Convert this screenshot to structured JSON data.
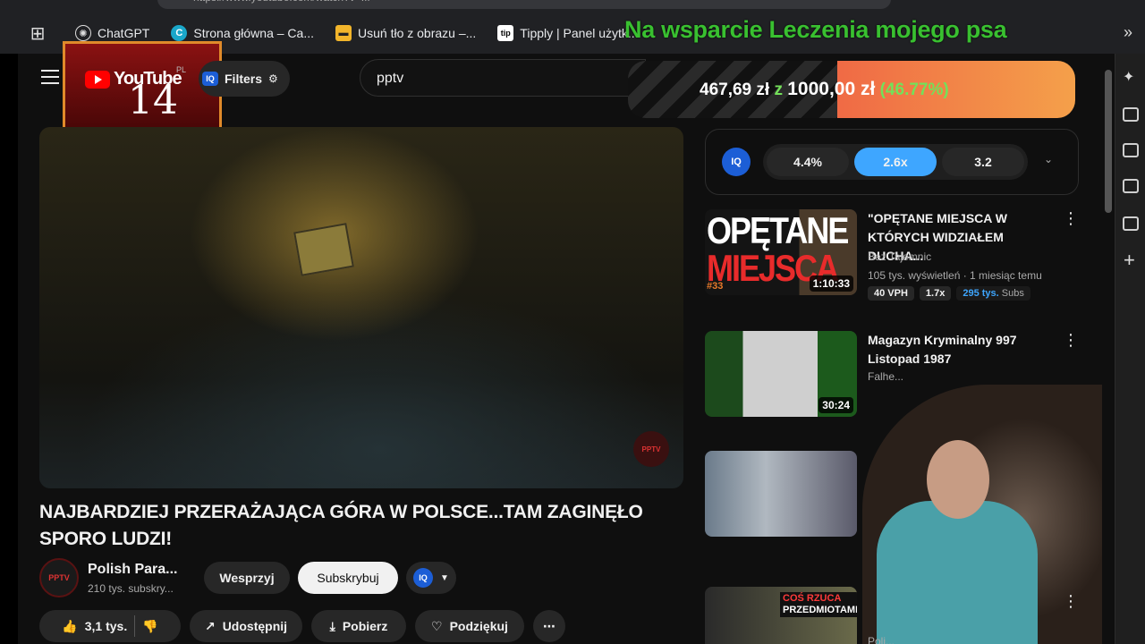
{
  "browser": {
    "url": "https://www.youtube.com/watch?v=...",
    "bookmarks": [
      {
        "label": "ChatGPT",
        "icon": "chatgpt-icon"
      },
      {
        "label": "Strona główna – Ca...",
        "icon": "canva-icon"
      },
      {
        "label": "Usuń tło z obrazu –...",
        "icon": "removebg-icon"
      },
      {
        "label": "Tipply | Panel użytk...",
        "icon": "tipply-icon"
      }
    ]
  },
  "overlay": {
    "support_text": "Na wsparcie Leczenia mojego psa"
  },
  "donation_goal": {
    "current": "467,69 zł",
    "separator": "z",
    "target": "1000,00 zł",
    "percent_text": "(46.77%)",
    "progress": 0.4677
  },
  "header": {
    "logo_word": "YouTube",
    "logo_region": "PL",
    "logo_overlay_number": "14",
    "filters_label": "Filters",
    "iq_label": "IQ",
    "search_value": "pptv"
  },
  "video": {
    "title": "NAJBARDZIEJ PRZERAŻAJĄCA GÓRA W POLSCE...TAM ZAGINĘŁO SPORO LUDZI!",
    "watermark": "PPTV",
    "channel_name": "Polish Para...",
    "channel_subs": "210 tys. subskry...",
    "channel_avatar_text": "PPTV",
    "support_button": "Wesprzyj",
    "subscribe_button": "Subskrybuj",
    "likes": "3,1 tys.",
    "share": "Udostępnij",
    "download": "Pobierz",
    "thanks": "Podziękuj",
    "more": "⋯"
  },
  "speed": {
    "options": [
      "4.4%",
      "2.6x",
      "3.2"
    ],
    "active_index": 1,
    "iq_label": "IQ"
  },
  "recommendations": [
    {
      "title": "\"OPĘTANE MIEJSCA W KTÓRYCH WIDZIAŁEM DUCHA...",
      "channel": "Bez Tajemnic",
      "meta": "105 tys. wyświetleń · 1 miesiąc temu",
      "duration": "1:10:33",
      "thumb_line1": "OPĘTANE",
      "thumb_line2": "MIEJSCA",
      "thumb_tag": "#33",
      "stats": [
        "40 VPH",
        "1.7x"
      ],
      "subs_value": "295 tys.",
      "subs_label": "Subs"
    },
    {
      "title": "Magazyn Kryminalny 997 Listopad 1987",
      "channel": "Falhe...",
      "duration": "30:24"
    },
    {
      "title": "",
      "channel": ""
    }
  ],
  "bottom_rec": {
    "thumb_text1": "COŚ RZUCA",
    "thumb_text2": "PRZEDMIOTAMI",
    "channel": "Poli..."
  },
  "colors": {
    "accent_blue": "#3ea6ff",
    "yt_red": "#ff0000",
    "goal_green": "#74e05a",
    "overlay_green": "#39c030",
    "goal_orange": "#f06a45"
  }
}
